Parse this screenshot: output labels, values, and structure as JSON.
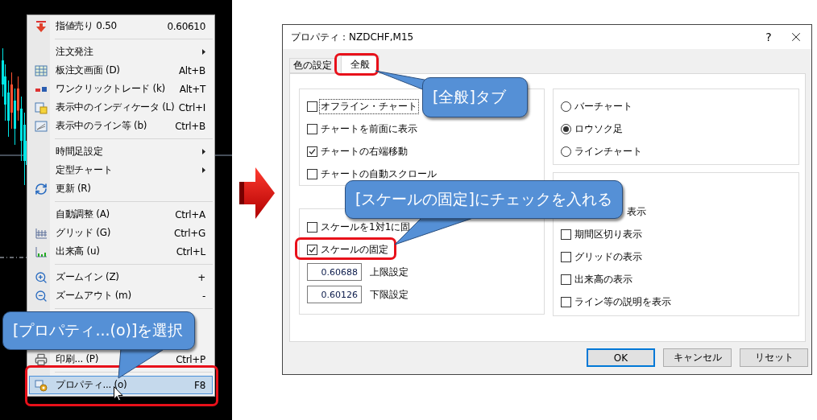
{
  "context_menu": {
    "items": [
      {
        "kind": "item",
        "label": "指値売り 0.50",
        "shortcut": "0.60610",
        "submenu": false,
        "selected": false
      },
      {
        "kind": "separator"
      },
      {
        "kind": "item",
        "label": "注文発注",
        "submenu": true,
        "selected": false
      },
      {
        "kind": "item",
        "label": "板注文画面 (D)",
        "shortcut": "Alt+B",
        "submenu": false,
        "selected": false
      },
      {
        "kind": "item",
        "label": "ワンクリックトレード (k)",
        "shortcut": "Alt+T",
        "submenu": false,
        "selected": false
      },
      {
        "kind": "item",
        "label": "表示中のインディケータ (L)",
        "shortcut": "Ctrl+I",
        "submenu": false,
        "selected": false
      },
      {
        "kind": "item",
        "label": "表示中のライン等 (b)",
        "shortcut": "Ctrl+B",
        "submenu": false,
        "selected": false
      },
      {
        "kind": "separator"
      },
      {
        "kind": "item",
        "label": "時間足設定",
        "submenu": true,
        "selected": false
      },
      {
        "kind": "item",
        "label": "定型チャート",
        "submenu": true,
        "selected": false
      },
      {
        "kind": "item",
        "label": "更新 (R)",
        "submenu": false,
        "selected": false
      },
      {
        "kind": "separator"
      },
      {
        "kind": "item",
        "label": "自動調整 (A)",
        "shortcut": "Ctrl+A",
        "submenu": false,
        "selected": false
      },
      {
        "kind": "item",
        "label": "グリッド (G)",
        "shortcut": "Ctrl+G",
        "submenu": false,
        "selected": false
      },
      {
        "kind": "item",
        "label": "出来高 (u)",
        "shortcut": "Ctrl+L",
        "submenu": false,
        "selected": false
      },
      {
        "kind": "separator"
      },
      {
        "kind": "item",
        "label": "ズームイン (Z)",
        "shortcut": "+",
        "submenu": false,
        "selected": false
      },
      {
        "kind": "item",
        "label": "ズームアウト (m)",
        "shortcut": "-",
        "submenu": false,
        "selected": false
      },
      {
        "kind": "separator"
      },
      {
        "kind": "gap"
      },
      {
        "kind": "item",
        "label": "印刷... (P)",
        "shortcut": "Ctrl+P",
        "submenu": false,
        "selected": false
      },
      {
        "kind": "separator"
      },
      {
        "kind": "item",
        "label": "プロパティ... (o)",
        "shortcut": "F8",
        "submenu": false,
        "selected": true
      }
    ]
  },
  "dialog": {
    "title": "プロパティ：NZDCHF,M15",
    "help": "?",
    "tabs": [
      {
        "label": "色の設定",
        "selected": false
      },
      {
        "label": "全般",
        "selected": true
      }
    ],
    "options": [
      {
        "label": "オフライン・チャート",
        "checked": false,
        "focused": true
      },
      {
        "label": "チャートを前面に表示",
        "checked": false,
        "focused": false
      },
      {
        "label": "チャートの右端移動",
        "checked": true,
        "focused": false
      },
      {
        "label": "チャートの自動スクロール",
        "checked": false,
        "focused": false
      }
    ],
    "scale_options": [
      {
        "label": "スケールを1対1に固",
        "checked": false
      },
      {
        "label": "スケールの固定",
        "checked": true
      }
    ],
    "scale_fields": [
      {
        "value": "0.60688",
        "label": "上限設定"
      },
      {
        "value": "0.60126",
        "label": "下限設定"
      }
    ],
    "chart_types": [
      {
        "label": "バーチャート",
        "selected": false
      },
      {
        "label": "ロウソク足",
        "selected": true
      },
      {
        "label": "ラインチャート",
        "selected": false
      }
    ],
    "display_options": [
      {
        "kind": "covered",
        "label": "表示"
      },
      {
        "kind": "checkbox",
        "label": "期間区切り表示",
        "checked": false
      },
      {
        "kind": "checkbox",
        "label": "グリッドの表示",
        "checked": false
      },
      {
        "kind": "checkbox",
        "label": "出来高の表示",
        "checked": false
      },
      {
        "kind": "checkbox",
        "label": "ライン等の説明を表示",
        "checked": false
      }
    ],
    "buttons": [
      {
        "label": "OK",
        "default": true
      },
      {
        "label": "キャンセル",
        "default": false
      },
      {
        "label": "リセット",
        "default": false
      }
    ]
  },
  "callouts": [
    {
      "text": "[全般]タブ"
    },
    {
      "text": "[スケールの固定]にチェックを入れる"
    },
    {
      "text": "[プロパティ...(o)]を選択"
    }
  ]
}
